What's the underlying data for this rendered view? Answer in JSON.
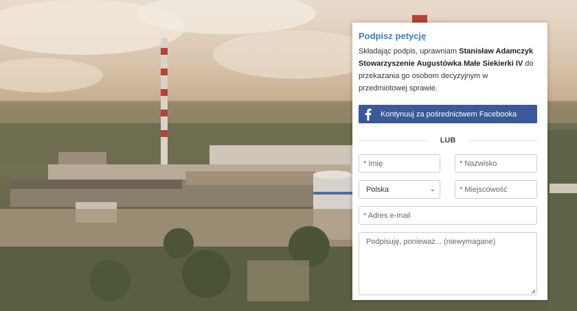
{
  "petition": {
    "title": "Podpisz petycję",
    "consent_prefix": "Składając podpis, uprawniam",
    "consent_entity": "Stanisław Adamczyk Stowarzyszenie Augustówka Małe Siekierki IV",
    "consent_suffix": "do przekazania go osobom decyzyjnym w przedmiotowej sprawie.",
    "facebook_button": "Kontynuuj za pośrednictwem Facebooka",
    "divider": "LUB",
    "fields": {
      "first_name_placeholder": "* Imię",
      "last_name_placeholder": "* Nazwisko",
      "country_value": "Polska",
      "city_placeholder": "* Miejscowość",
      "email_placeholder": "* Adres e-mail",
      "comment_placeholder": "Podpisuję, ponieważ... (niewymagane)"
    }
  },
  "colors": {
    "title": "#3b7fc4",
    "facebook": "#3b5998"
  },
  "icons": {
    "facebook": "facebook-icon",
    "select_arrow": "chevron-down-icon",
    "resize": "resize-grip-icon"
  }
}
